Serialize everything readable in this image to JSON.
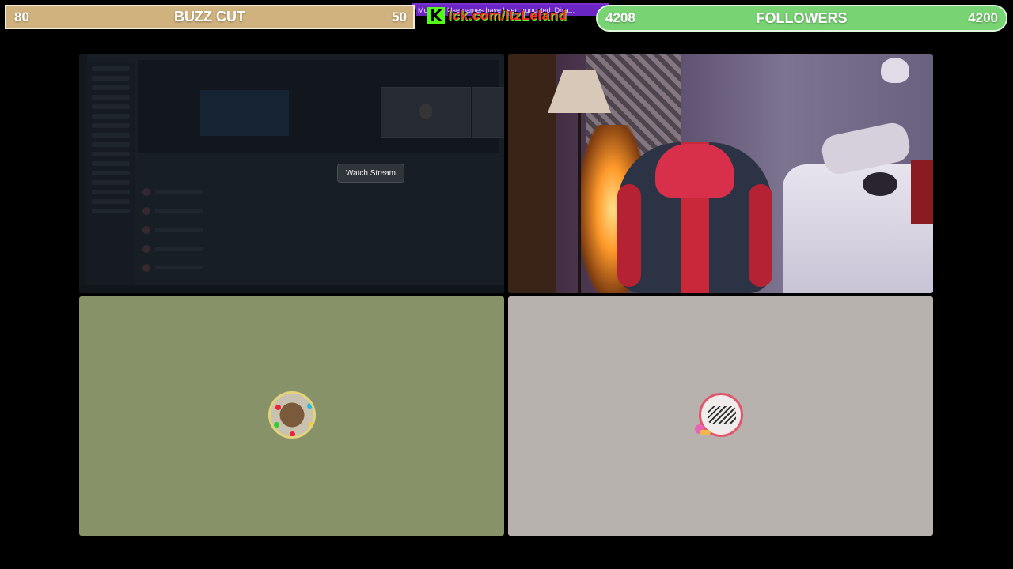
{
  "subathon_goal": {
    "current": "80",
    "title": "BUZZ CUT",
    "target": "50",
    "color": "#cfb27e"
  },
  "notice": {
    "text": "Mo... ble Usernames have been truncated.  Disa..."
  },
  "kick_banner": {
    "logo_letter": "K",
    "url": "ick.com/ItzLeland",
    "logo_color": "#53fc18"
  },
  "followers_goal": {
    "current": "4208",
    "title": "FOLLOWERS",
    "target": "4200",
    "progress_fraction": 1.0,
    "color": "#5fc35a"
  },
  "tiles": {
    "screen_share": {
      "watch_button_label": "Watch Stream"
    },
    "webcam": {},
    "participant_1": {
      "background": "#879268"
    },
    "participant_2": {
      "background": "#b7b2ae"
    }
  }
}
